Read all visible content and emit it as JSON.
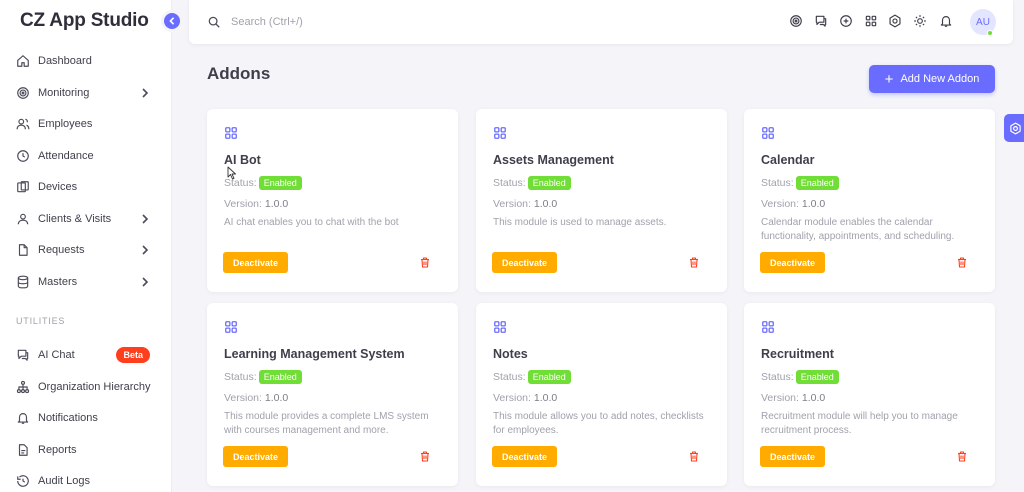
{
  "app": {
    "brand": "CZ App Studio"
  },
  "sidebar": {
    "items": [
      {
        "label": "Dashboard",
        "icon": "home-icon"
      },
      {
        "label": "Monitoring",
        "icon": "target-icon",
        "chevron": true
      },
      {
        "label": "Employees",
        "icon": "users-icon"
      },
      {
        "label": "Attendance",
        "icon": "clock-icon"
      },
      {
        "label": "Devices",
        "icon": "devices-icon"
      },
      {
        "label": "Clients & Visits",
        "icon": "user-icon",
        "chevron": true
      },
      {
        "label": "Requests",
        "icon": "file-icon",
        "chevron": true
      },
      {
        "label": "Masters",
        "icon": "database-icon",
        "chevron": true
      }
    ],
    "utilities_label": "UTILITIES",
    "utilities": [
      {
        "label": "AI Chat",
        "icon": "chat-icon",
        "badge": "Beta"
      },
      {
        "label": "Organization Hierarchy",
        "icon": "hierarchy-icon"
      },
      {
        "label": "Notifications",
        "icon": "bell-icon"
      },
      {
        "label": "Reports",
        "icon": "report-icon"
      },
      {
        "label": "Audit Logs",
        "icon": "history-icon"
      }
    ]
  },
  "topbar": {
    "search_placeholder": "Search (Ctrl+/)",
    "avatar_initials": "AU"
  },
  "page": {
    "title": "Addons",
    "add_button": "Add New Addon"
  },
  "labels": {
    "status": "Status:",
    "version": "Version:",
    "deactivate": "Deactivate"
  },
  "addons": [
    {
      "name": "AI Bot",
      "status": "Enabled",
      "version": "1.0.0",
      "description": "AI chat enables you to chat with the bot"
    },
    {
      "name": "Assets Management",
      "status": "Enabled",
      "version": "1.0.0",
      "description": "This module is used to manage assets."
    },
    {
      "name": "Calendar",
      "status": "Enabled",
      "version": "1.0.0",
      "description": "Calendar module enables the calendar functionality, appointments, and scheduling."
    },
    {
      "name": "Learning Management System",
      "status": "Enabled",
      "version": "1.0.0",
      "description": "This module provides a complete LMS system with courses management and more."
    },
    {
      "name": "Notes",
      "status": "Enabled",
      "version": "1.0.0",
      "description": "This module allows you to add notes, checklists for employees."
    },
    {
      "name": "Recruitment",
      "status": "Enabled",
      "version": "1.0.0",
      "description": "Recruitment module will help you to manage recruitment process."
    }
  ],
  "colors": {
    "primary": "#696cff",
    "success": "#71dd37",
    "warning": "#ffab00",
    "danger": "#ff3e1d"
  }
}
